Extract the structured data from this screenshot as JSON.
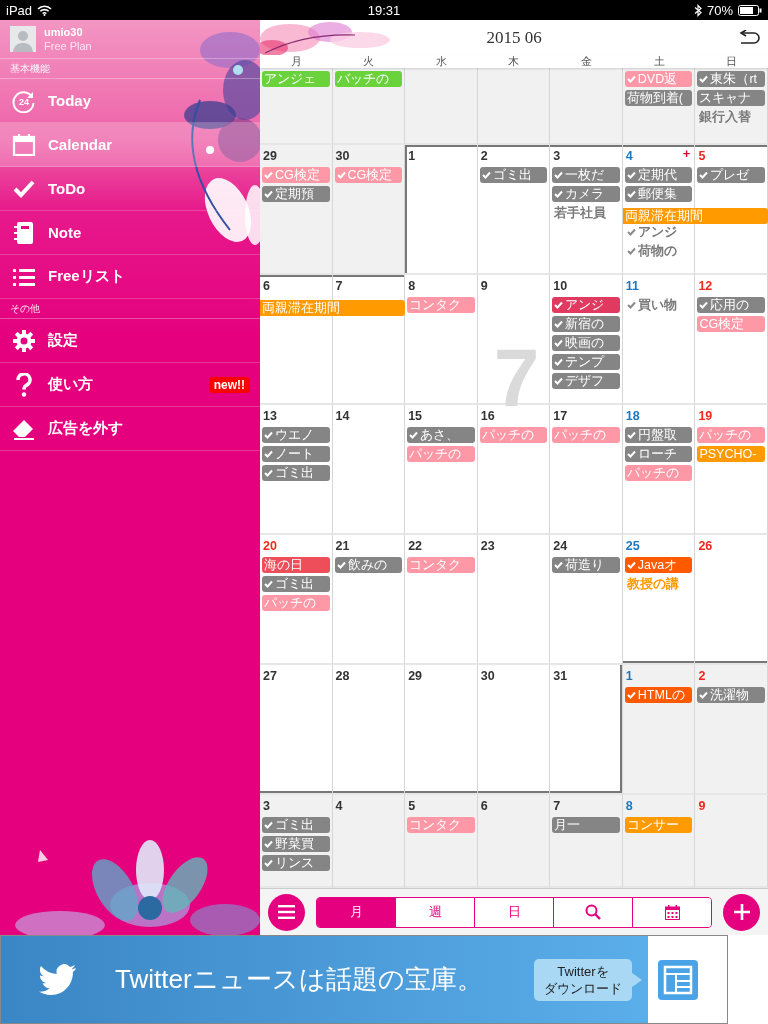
{
  "status_bar": {
    "device": "iPad",
    "time": "19:31",
    "battery": "70%"
  },
  "sidebar": {
    "user": {
      "name": "umio30",
      "plan": "Free Plan"
    },
    "sections": [
      {
        "title": "基本機能",
        "items": [
          {
            "label": "Today",
            "selected": false,
            "icon_text": "24"
          },
          {
            "label": "Calendar",
            "selected": true
          },
          {
            "label": "ToDo",
            "selected": false
          },
          {
            "label": "Note",
            "selected": false
          },
          {
            "label": "Freeリスト",
            "selected": false
          }
        ]
      },
      {
        "title": "その他",
        "items": [
          {
            "label": "設定",
            "selected": false
          },
          {
            "label": "使い方",
            "selected": false,
            "badge": "new!!"
          },
          {
            "label": "広告を外す",
            "selected": false
          }
        ]
      }
    ]
  },
  "calendar": {
    "title": "2015 06",
    "weekdays": [
      "月",
      "火",
      "水",
      "木",
      "金",
      "土",
      "日"
    ],
    "rows": [
      {
        "cells": [
          {
            "in_month": false,
            "events": [
              {
                "kind": "chip",
                "text": "アンジェ",
                "color": "#6ad33c",
                "checked": false
              }
            ]
          },
          {
            "in_month": false,
            "events": [
              {
                "kind": "chip",
                "text": "バッチの",
                "color": "#6ad33c",
                "checked": false
              }
            ]
          },
          {
            "in_month": false
          },
          {
            "in_month": false
          },
          {
            "in_month": false
          },
          {
            "in_month": false,
            "events": [
              {
                "kind": "chip",
                "text": "DVD返",
                "color": "#ff98a6",
                "checked": true
              },
              {
                "kind": "chip",
                "text": "荷物到着(",
                "color": "#858585",
                "checked": false
              }
            ]
          },
          {
            "in_month": false,
            "events": [
              {
                "kind": "chip",
                "text": "東朱（rt",
                "color": "#858585",
                "checked": true
              },
              {
                "kind": "chip",
                "text": "スキャナ",
                "color": "#858585",
                "checked": false
              },
              {
                "kind": "text",
                "text": "銀行入替",
                "color": "#7a7a7a",
                "checked": false
              }
            ]
          }
        ]
      },
      {
        "cells": [
          {
            "day": "29",
            "color": "#333333",
            "in_month": false,
            "events": [
              {
                "kind": "chip",
                "text": "CG検定",
                "color": "#ff98a6",
                "checked": true
              },
              {
                "kind": "chip",
                "text": "定期預",
                "color": "#858585",
                "checked": true
              }
            ]
          },
          {
            "day": "30",
            "color": "#333333",
            "in_month": false,
            "events": [
              {
                "kind": "chip",
                "text": "CG検定",
                "color": "#ff98a6",
                "checked": true
              }
            ]
          },
          {
            "day": "1",
            "color": "#333333",
            "in_month": true
          },
          {
            "day": "2",
            "color": "#333333",
            "in_month": true,
            "events": [
              {
                "kind": "chip",
                "text": "ゴミ出",
                "color": "#858585",
                "checked": true
              }
            ]
          },
          {
            "day": "3",
            "color": "#333333",
            "in_month": true,
            "events": [
              {
                "kind": "chip",
                "text": "一枚だ",
                "color": "#858585",
                "checked": true
              },
              {
                "kind": "chip",
                "text": "カメラ",
                "color": "#858585",
                "checked": true
              },
              {
                "kind": "text",
                "text": "若手社員",
                "color": "#7a7a7a",
                "checked": false
              }
            ]
          },
          {
            "day": "4",
            "color": "#1a78c2",
            "in_month": true,
            "more": "+",
            "events": [
              {
                "kind": "chip",
                "text": "定期代",
                "color": "#858585",
                "checked": true
              },
              {
                "kind": "chip",
                "text": "郵便集",
                "color": "#858585",
                "checked": true
              },
              {
                "kind": "bar",
                "text": "両親滞在期間",
                "color": "#ff9a00",
                "checked": false,
                "continues": true
              },
              {
                "kind": "text",
                "text": "アンジ",
                "color": "#7a7a7a",
                "checked": true
              },
              {
                "kind": "text",
                "text": "荷物の",
                "color": "#7a7a7a",
                "checked": true
              }
            ]
          },
          {
            "day": "5",
            "color": "#ee2a1e",
            "in_month": true,
            "events": [
              {
                "kind": "chip",
                "text": "プレゼ",
                "color": "#858585",
                "checked": true
              }
            ]
          }
        ]
      },
      {
        "cells": [
          {
            "day": "6",
            "color": "#333333",
            "in_month": true,
            "events": [
              {
                "kind": "bar",
                "text": "両親滞在期間",
                "color": "#ff9a00",
                "checked": false,
                "continues": true
              }
            ]
          },
          {
            "day": "7",
            "color": "#333333",
            "in_month": true
          },
          {
            "day": "8",
            "color": "#333333",
            "in_month": true,
            "events": [
              {
                "kind": "chip",
                "text": "コンタク",
                "color": "#ff98a6",
                "checked": false
              }
            ]
          },
          {
            "day": "9",
            "color": "#333333",
            "in_month": true,
            "watermark": "7"
          },
          {
            "day": "10",
            "color": "#333333",
            "in_month": true,
            "events": [
              {
                "kind": "chip",
                "text": "アンジ",
                "color": "#e03a60",
                "checked": true
              },
              {
                "kind": "chip",
                "text": "新宿の",
                "color": "#858585",
                "checked": true
              },
              {
                "kind": "chip",
                "text": "映画の",
                "color": "#858585",
                "checked": true
              },
              {
                "kind": "chip",
                "text": "テンプ",
                "color": "#858585",
                "checked": true
              },
              {
                "kind": "chip",
                "text": "デザフ",
                "color": "#858585",
                "checked": true
              }
            ]
          },
          {
            "day": "11",
            "color": "#1a78c2",
            "in_month": true,
            "events": [
              {
                "kind": "text",
                "text": "買い物",
                "color": "#7a7a7a",
                "checked": true
              }
            ]
          },
          {
            "day": "12",
            "color": "#ee2a1e",
            "in_month": true,
            "events": [
              {
                "kind": "chip",
                "text": "応用の",
                "color": "#858585",
                "checked": true
              },
              {
                "kind": "chip",
                "text": "CG検定",
                "color": "#ff98a6",
                "checked": false
              }
            ]
          }
        ]
      },
      {
        "cells": [
          {
            "day": "13",
            "color": "#333333",
            "in_month": true,
            "events": [
              {
                "kind": "chip",
                "text": "ウエノ",
                "color": "#858585",
                "checked": true
              },
              {
                "kind": "chip",
                "text": "ノート",
                "color": "#858585",
                "checked": true
              },
              {
                "kind": "chip",
                "text": "ゴミ出",
                "color": "#858585",
                "checked": true
              }
            ]
          },
          {
            "day": "14",
            "color": "#333333",
            "in_month": true
          },
          {
            "day": "15",
            "color": "#333333",
            "in_month": true,
            "events": [
              {
                "kind": "chip",
                "text": "あさ、",
                "color": "#858585",
                "checked": true
              },
              {
                "kind": "chip",
                "text": "パッチの",
                "color": "#ff98a6",
                "checked": false
              }
            ]
          },
          {
            "day": "16",
            "color": "#333333",
            "in_month": true,
            "events": [
              {
                "kind": "chip",
                "text": "パッチの",
                "color": "#ff98a6",
                "checked": false
              }
            ]
          },
          {
            "day": "17",
            "color": "#333333",
            "in_month": true,
            "events": [
              {
                "kind": "chip",
                "text": "パッチの",
                "color": "#ff98a6",
                "checked": false
              }
            ]
          },
          {
            "day": "18",
            "color": "#1a78c2",
            "in_month": true,
            "events": [
              {
                "kind": "chip",
                "text": "円盤取",
                "color": "#858585",
                "checked": true
              },
              {
                "kind": "chip",
                "text": "ローチ",
                "color": "#858585",
                "checked": true
              },
              {
                "kind": "chip",
                "text": "パッチの",
                "color": "#ff98a6",
                "checked": false
              }
            ]
          },
          {
            "day": "19",
            "color": "#ee2a1e",
            "in_month": true,
            "events": [
              {
                "kind": "chip",
                "text": "パッチの",
                "color": "#ff98a6",
                "checked": false
              },
              {
                "kind": "chip",
                "text": "PSYCHO-",
                "color": "#ff9a00",
                "checked": false
              }
            ]
          }
        ]
      },
      {
        "cells": [
          {
            "day": "20",
            "color": "#ee2a1e",
            "in_month": true,
            "events": [
              {
                "kind": "chip",
                "text": "海の日",
                "color": "#ee4d5a",
                "checked": false
              },
              {
                "kind": "chip",
                "text": "ゴミ出",
                "color": "#858585",
                "checked": true
              },
              {
                "kind": "chip",
                "text": "パッチの",
                "color": "#ff98a6",
                "checked": false
              }
            ]
          },
          {
            "day": "21",
            "color": "#333333",
            "in_month": true,
            "events": [
              {
                "kind": "chip",
                "text": "飲みの",
                "color": "#858585",
                "checked": true
              }
            ]
          },
          {
            "day": "22",
            "color": "#333333",
            "in_month": true,
            "events": [
              {
                "kind": "chip",
                "text": "コンタク",
                "color": "#ff98a6",
                "checked": false
              }
            ]
          },
          {
            "day": "23",
            "color": "#333333",
            "in_month": true
          },
          {
            "day": "24",
            "color": "#333333",
            "in_month": true,
            "events": [
              {
                "kind": "chip",
                "text": "荷造り",
                "color": "#858585",
                "checked": true
              }
            ]
          },
          {
            "day": "25",
            "color": "#1a78c2",
            "in_month": true,
            "events": [
              {
                "kind": "chip",
                "text": "Javaオ",
                "color": "#ff5a00",
                "checked": true
              },
              {
                "kind": "text",
                "text": "教授の講",
                "color": "#ff9a00",
                "checked": false
              }
            ]
          },
          {
            "day": "26",
            "color": "#ee2a1e",
            "in_month": true
          }
        ]
      },
      {
        "cells": [
          {
            "day": "27",
            "color": "#333333",
            "in_month": true
          },
          {
            "day": "28",
            "color": "#333333",
            "in_month": true
          },
          {
            "day": "29",
            "color": "#333333",
            "in_month": true
          },
          {
            "day": "30",
            "color": "#333333",
            "in_month": true
          },
          {
            "day": "31",
            "color": "#333333",
            "in_month": true
          },
          {
            "day": "1",
            "color": "#1a78c2",
            "in_month": false,
            "events": [
              {
                "kind": "chip",
                "text": "HTMLの",
                "color": "#ff5a00",
                "checked": true
              }
            ]
          },
          {
            "day": "2",
            "color": "#ee2a1e",
            "in_month": false,
            "events": [
              {
                "kind": "chip",
                "text": "洗濯物",
                "color": "#858585",
                "checked": true
              }
            ]
          }
        ]
      },
      {
        "cells": [
          {
            "day": "3",
            "color": "#333333",
            "in_month": false,
            "events": [
              {
                "kind": "chip",
                "text": "ゴミ出",
                "color": "#858585",
                "checked": true
              },
              {
                "kind": "chip",
                "text": "野菜買",
                "color": "#858585",
                "checked": true
              },
              {
                "kind": "chip",
                "text": "リンス",
                "color": "#858585",
                "checked": true
              }
            ]
          },
          {
            "day": "4",
            "color": "#333333",
            "in_month": false
          },
          {
            "day": "5",
            "color": "#333333",
            "in_month": false,
            "events": [
              {
                "kind": "chip",
                "text": "コンタク",
                "color": "#ff98a6",
                "checked": false
              }
            ]
          },
          {
            "day": "6",
            "color": "#333333",
            "in_month": false
          },
          {
            "day": "7",
            "color": "#333333",
            "in_month": false,
            "events": [
              {
                "kind": "chip",
                "text": "月一",
                "color": "#858585",
                "checked": false
              }
            ]
          },
          {
            "day": "8",
            "color": "#1a78c2",
            "in_month": false,
            "events": [
              {
                "kind": "chip",
                "text": "コンサー",
                "color": "#ff9a00",
                "checked": false
              }
            ]
          },
          {
            "day": "9",
            "color": "#ee2a1e",
            "in_month": false
          }
        ]
      }
    ]
  },
  "toolbar": {
    "views": [
      {
        "kind": "text",
        "label": "月",
        "selected": true
      },
      {
        "kind": "text",
        "label": "週",
        "selected": false
      },
      {
        "kind": "text",
        "label": "日",
        "selected": false
      },
      {
        "kind": "search",
        "selected": false
      },
      {
        "kind": "month-grid",
        "selected": false
      }
    ]
  },
  "ad": {
    "headline": "Twitterニュースは話題の宝庫。",
    "button_lines": [
      "Twitterを",
      "ダウンロード"
    ]
  }
}
